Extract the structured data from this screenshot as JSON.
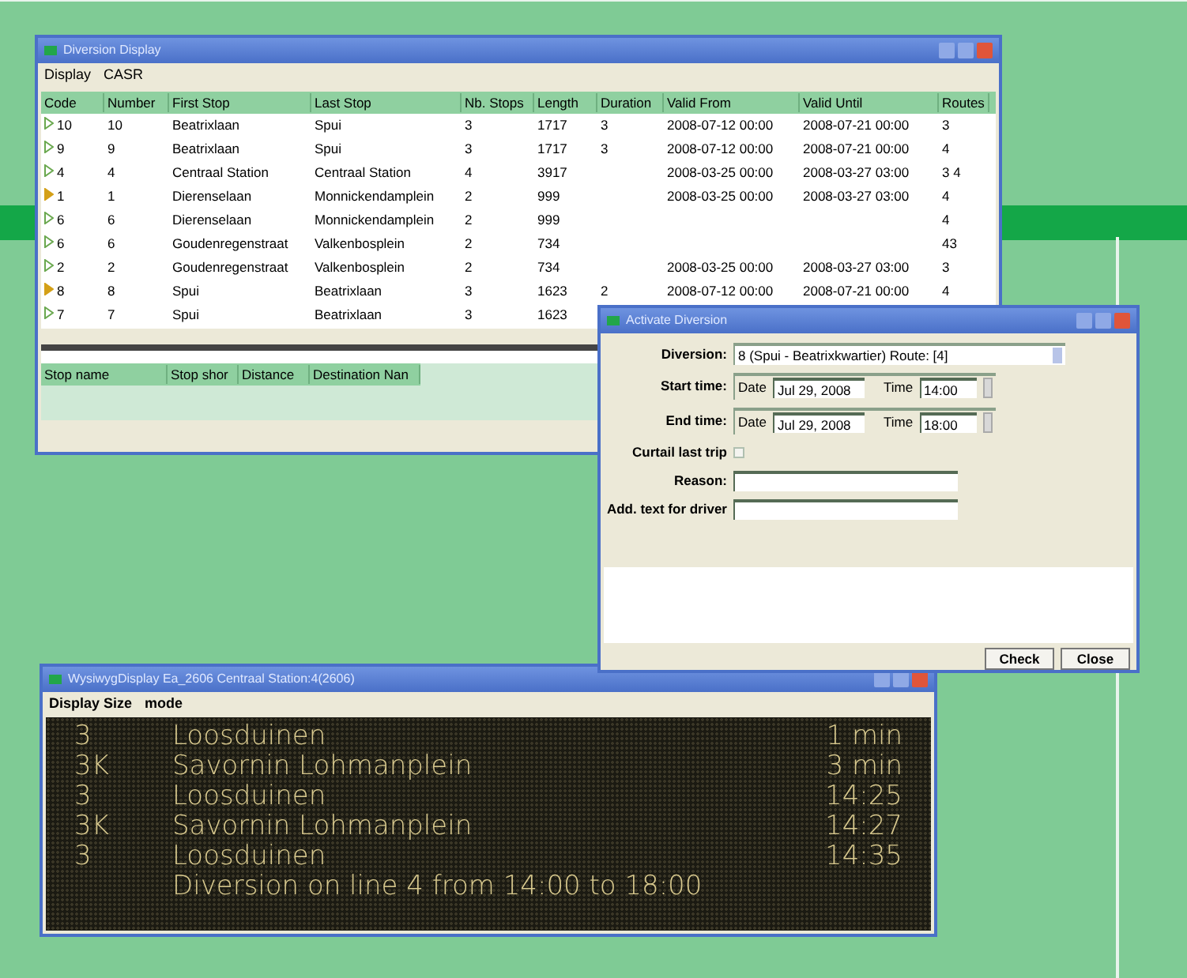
{
  "diversion_window": {
    "title": "Diversion Display",
    "menu": [
      "Display",
      "CASR"
    ],
    "columns": [
      "Code",
      "Number",
      "First Stop",
      "Last Stop",
      "Nb. Stops",
      "Length",
      "Duration",
      "Valid From",
      "Valid Until",
      "Routes"
    ],
    "rows": [
      {
        "color": "#6aa84f",
        "cells": [
          "10",
          "10",
          "Beatrixlaan",
          "Spui",
          "3",
          "1717",
          "3",
          "2008-07-12 00:00",
          "2008-07-21 00:00",
          "3"
        ]
      },
      {
        "color": "#6aa84f",
        "cells": [
          "9",
          "9",
          "Beatrixlaan",
          "Spui",
          "3",
          "1717",
          "3",
          "2008-07-12 00:00",
          "2008-07-21 00:00",
          "4"
        ]
      },
      {
        "color": "#6aa84f",
        "cells": [
          "4",
          "4",
          "Centraal Station",
          "Centraal Station",
          "4",
          "3917",
          "",
          "2008-03-25 00:00",
          "2008-03-27 03:00",
          "3 4"
        ]
      },
      {
        "color": "#d4a017",
        "cells": [
          "1",
          "1",
          "Dierenselaan",
          "Monnickendamplein",
          "2",
          "999",
          "",
          "2008-03-25 00:00",
          "2008-03-27 03:00",
          "4"
        ]
      },
      {
        "color": "#6aa84f",
        "cells": [
          "6",
          "6",
          "Dierenselaan",
          "Monnickendamplein",
          "2",
          "999",
          "",
          "",
          "",
          "4"
        ]
      },
      {
        "color": "#6aa84f",
        "cells": [
          "6",
          "6",
          "Goudenregenstraat",
          "Valkenbosplein",
          "2",
          "734",
          "",
          "",
          "",
          "43"
        ]
      },
      {
        "color": "#6aa84f",
        "cells": [
          "2",
          "2",
          "Goudenregenstraat",
          "Valkenbosplein",
          "2",
          "734",
          "",
          "2008-03-25 00:00",
          "2008-03-27 03:00",
          "3"
        ]
      },
      {
        "color": "#d4a017",
        "cells": [
          "8",
          "8",
          "Spui",
          "Beatrixlaan",
          "3",
          "1623",
          "2",
          "2008-07-12 00:00",
          "2008-07-21 00:00",
          "4"
        ]
      },
      {
        "color": "#6aa84f",
        "cells": [
          "7",
          "7",
          "Spui",
          "Beatrixlaan",
          "3",
          "1623",
          "",
          "",
          "",
          ""
        ]
      }
    ],
    "stop_columns": [
      "Stop name",
      "Stop shor",
      "Distance",
      "Destination Nan"
    ]
  },
  "activate_window": {
    "title": "Activate Diversion",
    "diversion_label": "Diversion:",
    "diversion_value": "8 (Spui - Beatrixkwartier) Route: [4]",
    "start_label": "Start time:",
    "end_label": "End time:",
    "start_date_label": "Date",
    "start_time_label": "Time",
    "end_date_label": "Date",
    "end_time_label": "Time",
    "start_date": "Jul 29, 2008",
    "start_time": "14:00",
    "end_date": "Jul 29, 2008",
    "end_time": "18:00",
    "curtail_label": "Curtail last trip",
    "curtail_checked": false,
    "reason_label": "Reason:",
    "driver_label": "Add. text for driver",
    "buttons": [
      "Check",
      "Close"
    ]
  },
  "display_window": {
    "title": "WysiwygDisplay Ea_2606   Centraal Station:4(2606)",
    "menu": [
      "Display Size",
      "mode"
    ],
    "lines": [
      {
        "kind": "departure",
        "route": "3",
        "destination": "Loosduinen",
        "time": "1 min"
      },
      {
        "kind": "departure",
        "route": "3K",
        "destination": "Savornin Lohmanplein",
        "time": "3 min"
      },
      {
        "kind": "departure",
        "route": "3",
        "destination": "Loosduinen",
        "time": "14:25"
      },
      {
        "kind": "departure",
        "route": "3K",
        "destination": "Savornin Lohmanplein",
        "time": "14:27"
      },
      {
        "kind": "departure",
        "route": "3",
        "destination": "Loosduinen",
        "time": "14:35"
      },
      {
        "kind": "message",
        "text": "Diversion on line 4 from 14:00 to 18:00"
      }
    ]
  }
}
